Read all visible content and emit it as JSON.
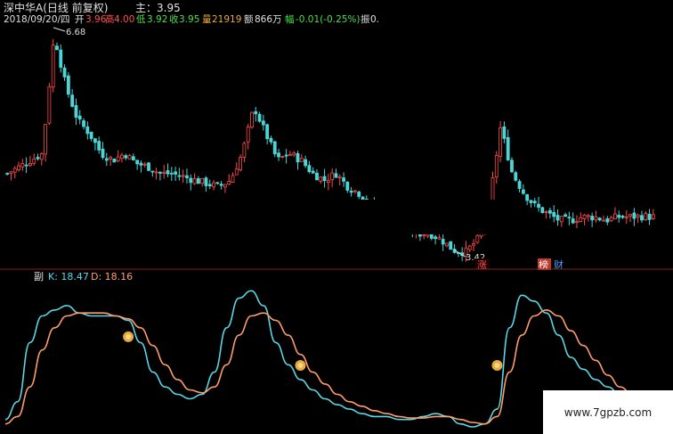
{
  "header": {
    "stock_title": "深中华A(日线 前复权)",
    "ma_label": "主：3.95",
    "date": "2018/09/20/四",
    "open_label": "开",
    "open_value": "3.96",
    "high_label": "高",
    "high_value": "4.00",
    "low_label": "低",
    "low_value": "3.92",
    "close_label": "收",
    "close_value": "3.95",
    "volume_label": "量",
    "volume_value": "21919",
    "amount_label": "额",
    "amount_value": "866万",
    "change_label": "幅",
    "change_value": "-0.01(-0.25%)",
    "amplitude_label": "振",
    "amplitude_value": "0."
  },
  "markers": {
    "high_price": "6.68",
    "low_price": "3.42",
    "badge_zhang": "涨",
    "badge_bang": "榜",
    "badge_cai": "财"
  },
  "sub_panel": {
    "panel_label": "副",
    "k_label": "K: 18.47",
    "d_label": "D: 18.16"
  },
  "watermark": "www.7gpzb.com",
  "colors": {
    "up": "#ff4a4a",
    "down": "#4ad6d6",
    "k_line": "#5ad7e6",
    "d_line": "#ff9d6a",
    "signal": "#e6a93c",
    "divider": "#8a1c1c",
    "header_text": "#e0e0e0",
    "up_text": "#ff5050",
    "down_text": "#4ae04a"
  },
  "chart_data": [
    {
      "type": "candlestick",
      "title": "深中华A(日线 前复权)",
      "annotations": [
        {
          "label": "6.68",
          "kind": "period-high"
        },
        {
          "label": "3.42",
          "kind": "period-low"
        }
      ],
      "price_path": [
        4.6,
        4.7,
        4.8,
        4.9,
        6.68,
        5.9,
        5.4,
        5.2,
        4.9,
        4.8,
        4.9,
        4.75,
        4.7,
        4.6,
        4.6,
        4.55,
        4.5,
        4.45,
        4.4,
        4.5,
        4.9,
        5.6,
        5.2,
        4.8,
        4.9,
        4.8,
        4.6,
        4.5,
        4.6,
        4.4,
        4.3,
        4.1,
        4.0,
        3.9,
        3.8,
        3.7,
        3.7,
        3.6,
        3.45,
        3.42,
        3.6,
        4.1,
        5.3,
        4.6,
        4.3,
        4.1,
        4.0,
        3.9,
        3.9,
        3.95,
        3.95,
        3.9,
        3.95,
        3.95,
        3.96,
        3.95
      ]
    },
    {
      "type": "line",
      "title": "",
      "series": [
        {
          "name": "K",
          "last": 18.47,
          "values": [
            8,
            20,
            60,
            78,
            82,
            85,
            80,
            78,
            78,
            78,
            75,
            60,
            40,
            30,
            25,
            22,
            25,
            40,
            70,
            90,
            95,
            85,
            60,
            45,
            35,
            28,
            22,
            18,
            15,
            12,
            10,
            10,
            8,
            8,
            10,
            12,
            10,
            5,
            3,
            5,
            15,
            70,
            92,
            88,
            80,
            65,
            50,
            42,
            35,
            30,
            25,
            22,
            20,
            18.47
          ]
        },
        {
          "name": "D",
          "last": 18.16,
          "values": [
            5,
            10,
            30,
            55,
            70,
            78,
            80,
            80,
            80,
            78,
            76,
            70,
            58,
            45,
            35,
            28,
            26,
            30,
            45,
            65,
            78,
            80,
            75,
            65,
            52,
            40,
            32,
            25,
            20,
            17,
            14,
            12,
            10,
            9,
            9,
            10,
            10,
            8,
            6,
            5,
            10,
            40,
            65,
            78,
            82,
            78,
            68,
            58,
            48,
            38,
            30,
            25,
            21,
            18.16
          ]
        }
      ],
      "signals": [
        10,
        24,
        40,
        55
      ]
    }
  ]
}
